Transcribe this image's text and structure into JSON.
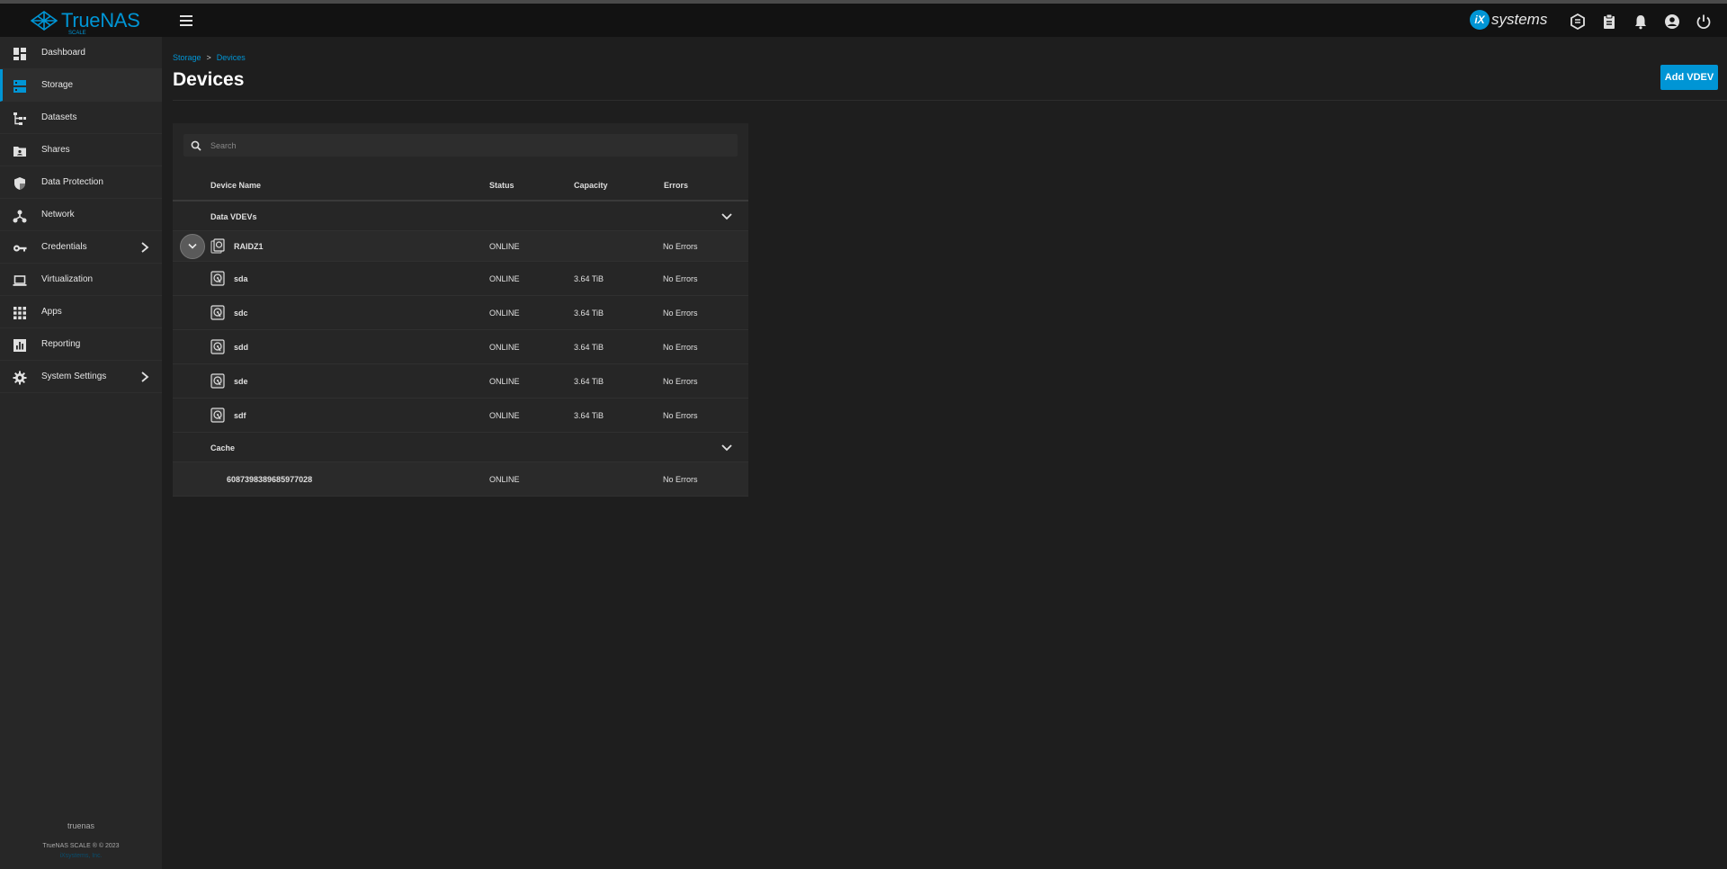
{
  "app": {
    "brand": "TrueNAS",
    "brand_sub": "SCALE",
    "vendor_mark": "iX",
    "vendor_text": "systems",
    "accent_color": "#0095d5"
  },
  "sidebar": {
    "items": [
      {
        "label": "Dashboard",
        "icon": "dashboard-icon"
      },
      {
        "label": "Storage",
        "icon": "storage-icon",
        "active": true
      },
      {
        "label": "Datasets",
        "icon": "datasets-icon"
      },
      {
        "label": "Shares",
        "icon": "shares-icon"
      },
      {
        "label": "Data Protection",
        "icon": "shield-icon"
      },
      {
        "label": "Network",
        "icon": "network-icon"
      },
      {
        "label": "Credentials",
        "icon": "key-icon",
        "has_children": true
      },
      {
        "label": "Virtualization",
        "icon": "laptop-icon"
      },
      {
        "label": "Apps",
        "icon": "apps-icon"
      },
      {
        "label": "Reporting",
        "icon": "chart-icon"
      },
      {
        "label": "System Settings",
        "icon": "gear-icon",
        "has_children": true
      }
    ],
    "hostname": "truenas",
    "copyright": "TrueNAS SCALE ® © 2023",
    "company_link": "iXsystems, Inc."
  },
  "breadcrumb": {
    "items": [
      "Storage",
      "Devices"
    ],
    "separator": ">"
  },
  "page": {
    "title": "Devices",
    "add_button": "Add VDEV"
  },
  "search": {
    "placeholder": "Search"
  },
  "table": {
    "columns": [
      "Device Name",
      "Status",
      "Capacity",
      "Errors"
    ],
    "groups": [
      {
        "label": "Data VDEVs",
        "vdev": {
          "name": "RAIDZ1",
          "status": "ONLINE",
          "capacity": "",
          "errors": "No Errors"
        },
        "disks": [
          {
            "name": "sda",
            "status": "ONLINE",
            "capacity": "3.64 TiB",
            "errors": "No Errors"
          },
          {
            "name": "sdc",
            "status": "ONLINE",
            "capacity": "3.64 TiB",
            "errors": "No Errors"
          },
          {
            "name": "sdd",
            "status": "ONLINE",
            "capacity": "3.64 TiB",
            "errors": "No Errors"
          },
          {
            "name": "sde",
            "status": "ONLINE",
            "capacity": "3.64 TiB",
            "errors": "No Errors"
          },
          {
            "name": "sdf",
            "status": "ONLINE",
            "capacity": "3.64 TiB",
            "errors": "No Errors"
          }
        ]
      },
      {
        "label": "Cache",
        "devices": [
          {
            "name": "6087398389685977028",
            "status": "ONLINE",
            "capacity": "",
            "errors": "No Errors"
          }
        ]
      }
    ]
  }
}
